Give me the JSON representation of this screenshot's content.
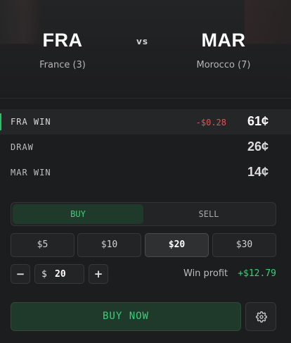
{
  "match": {
    "home": {
      "code": "FRA",
      "name": "France (3)"
    },
    "away": {
      "code": "MAR",
      "name": "Morocco (7)"
    },
    "vs_label": "vs"
  },
  "outcomes": [
    {
      "label": "FRA WIN",
      "delta": "-$0.28",
      "price": "61¢",
      "selected": true
    },
    {
      "label": "DRAW",
      "delta": "",
      "price": "26¢",
      "selected": false
    },
    {
      "label": "MAR WIN",
      "delta": "",
      "price": "14¢",
      "selected": false
    }
  ],
  "trade": {
    "tabs": {
      "buy": "BUY",
      "sell": "SELL",
      "active": "buy"
    },
    "amounts": [
      "$5",
      "$10",
      "$20",
      "$30"
    ],
    "selected_amount": "$20",
    "stepper": {
      "minus": "−",
      "plus": "+",
      "currency": "$",
      "value": "20"
    },
    "win_profit_label": "Win profit",
    "win_profit_value": "+$12.79",
    "submit_label": "BUY NOW",
    "settings_icon": "gear-icon"
  },
  "colors": {
    "accent_green": "#3ad07a",
    "negative_red": "#e05555",
    "background": "#1c1d1f"
  }
}
